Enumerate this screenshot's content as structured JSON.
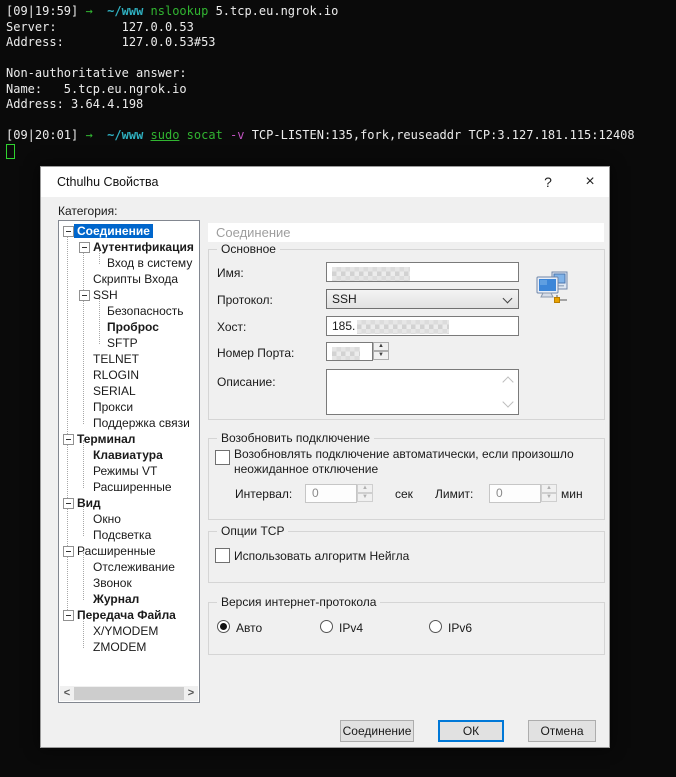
{
  "colors": {
    "tree_selection": "#0066cc",
    "ok_button_border": "#0078d7",
    "terminal_green": "#31b531",
    "terminal_cyan": "#2fb0c0",
    "terminal_magenta": "#c052c0",
    "terminal_background": "#0a0a0a",
    "dialog_background": "#f0f0f0"
  },
  "terminal": {
    "lines": [
      {
        "segments": [
          {
            "text": "[09|19:59] "
          },
          {
            "text": "→  "
          },
          {
            "text": "~/www "
          },
          {
            "text": "nslookup "
          },
          {
            "text": "5.tcp.eu.ngrok.io"
          }
        ]
      },
      {
        "text": "Server:         127.0.0.53"
      },
      {
        "text": "Address:        127.0.0.53#53"
      },
      {
        "text": ""
      },
      {
        "text": "Non-authoritative answer:"
      },
      {
        "text": "Name:   5.tcp.eu.ngrok.io"
      },
      {
        "text": "Address: 3.64.4.198"
      },
      {
        "text": ""
      },
      {
        "segments": [
          {
            "text": "[09|20:01] "
          },
          {
            "text": "→  "
          },
          {
            "text": "~/www "
          },
          {
            "text": "sudo"
          },
          {
            "text": " "
          },
          {
            "text": "socat"
          },
          {
            "text": " "
          },
          {
            "text": "-v"
          },
          {
            "text": " TCP-LISTEN:135,fork,reuseaddr TCP:3.127.181.115:12408"
          }
        ]
      }
    ]
  },
  "dialog": {
    "title": "Cthulhu Свойства",
    "help_label": "?",
    "close_label": "×",
    "category_label": "Категория:",
    "tree": {
      "items": [
        {
          "label": "Соединение"
        },
        {
          "label": "Аутентификация"
        },
        {
          "label": "Вход в систему"
        },
        {
          "label": "Скрипты Входа"
        },
        {
          "label": "SSH"
        },
        {
          "label": "Безопасность"
        },
        {
          "label": "Проброс"
        },
        {
          "label": "SFTP"
        },
        {
          "label": "TELNET"
        },
        {
          "label": "RLOGIN"
        },
        {
          "label": "SERIAL"
        },
        {
          "label": "Прокси"
        },
        {
          "label": "Поддержка связи"
        },
        {
          "label": "Терминал"
        },
        {
          "label": "Клавиатура"
        },
        {
          "label": "Режимы VT"
        },
        {
          "label": "Расширенные"
        },
        {
          "label": "Вид"
        },
        {
          "label": "Окно"
        },
        {
          "label": "Подсветка"
        },
        {
          "label": "Расширенные"
        },
        {
          "label": "Отслеживание"
        },
        {
          "label": "Звонок"
        },
        {
          "label": "Журнал"
        },
        {
          "label": "Передача Файла"
        },
        {
          "label": "X/YMODEM"
        },
        {
          "label": "ZMODEM"
        }
      ],
      "scroll_left": "<",
      "scroll_right": ">"
    },
    "panel": {
      "header": "Соединение",
      "basic": {
        "title": "Основное",
        "name_label": "Имя:",
        "protocol_label": "Протокол:",
        "protocol_value": "SSH",
        "host_label": "Хост:",
        "host_value": "185.",
        "port_label": "Номер Порта:",
        "description_label": "Описание:"
      },
      "reconnect": {
        "title": "Возобновить подключение",
        "checkbox_label": "Возобновлять подключение автоматически, если произошло неожиданное отключение",
        "interval_label": "Интервал:",
        "interval_value": "0",
        "interval_unit": "сек",
        "limit_label": "Лимит:",
        "limit_value": "0",
        "limit_unit": "мин"
      },
      "tcp": {
        "title": "Опции TCP",
        "checkbox_label": "Использовать алгоритм Нейгла"
      },
      "ip_version": {
        "title": "Версия интернет-протокола",
        "options": [
          {
            "label": "Авто",
            "selected": true
          },
          {
            "label": "IPv4",
            "selected": false
          },
          {
            "label": "IPv6",
            "selected": false
          }
        ]
      }
    },
    "buttons": {
      "connect": "Соединение",
      "ok": "ОК",
      "cancel": "Отмена"
    }
  }
}
